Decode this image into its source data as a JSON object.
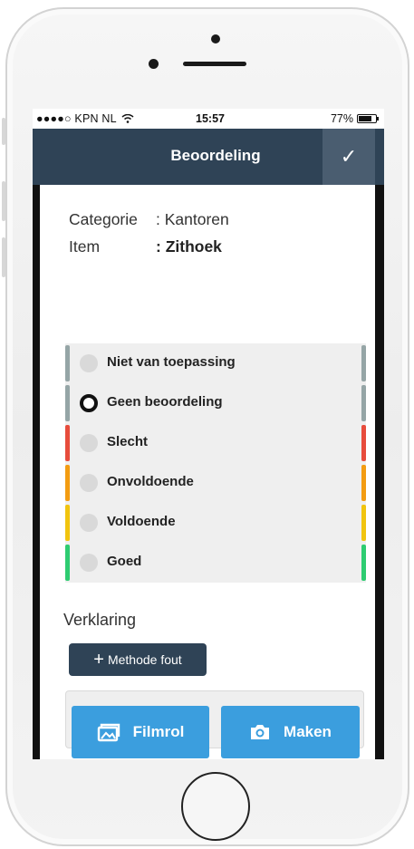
{
  "status_bar": {
    "carrier": "●●●●○ KPN NL",
    "time": "15:57",
    "battery": "77%",
    "battery_level": 0.77
  },
  "header": {
    "title": "Beoordeling",
    "confirm_icon": "checkmark-icon"
  },
  "info": {
    "category_label": "Categorie",
    "category_value": ": Kantoren",
    "item_label": "Item",
    "item_value": ": Zithoek"
  },
  "options": [
    {
      "label": "Niet van toepassing",
      "color": "#95a5a6",
      "selected": false
    },
    {
      "label": "Geen beoordeling",
      "color": "#95a5a6",
      "selected": true
    },
    {
      "label": "Slecht",
      "color": "#e74c3c",
      "selected": false
    },
    {
      "label": "Onvoldoende",
      "color": "#f39c12",
      "selected": false
    },
    {
      "label": "Voldoende",
      "color": "#f1c40f",
      "selected": false
    },
    {
      "label": "Goed",
      "color": "#2ecc71",
      "selected": false
    }
  ],
  "verklaring": {
    "label": "Verklaring",
    "methode_button": "Methode fout",
    "text_value": ""
  },
  "actions": {
    "filmrol": "Filmrol",
    "maken": "Maken"
  },
  "colors": {
    "navbar": "#2f4356",
    "accent": "#3b9ede"
  }
}
